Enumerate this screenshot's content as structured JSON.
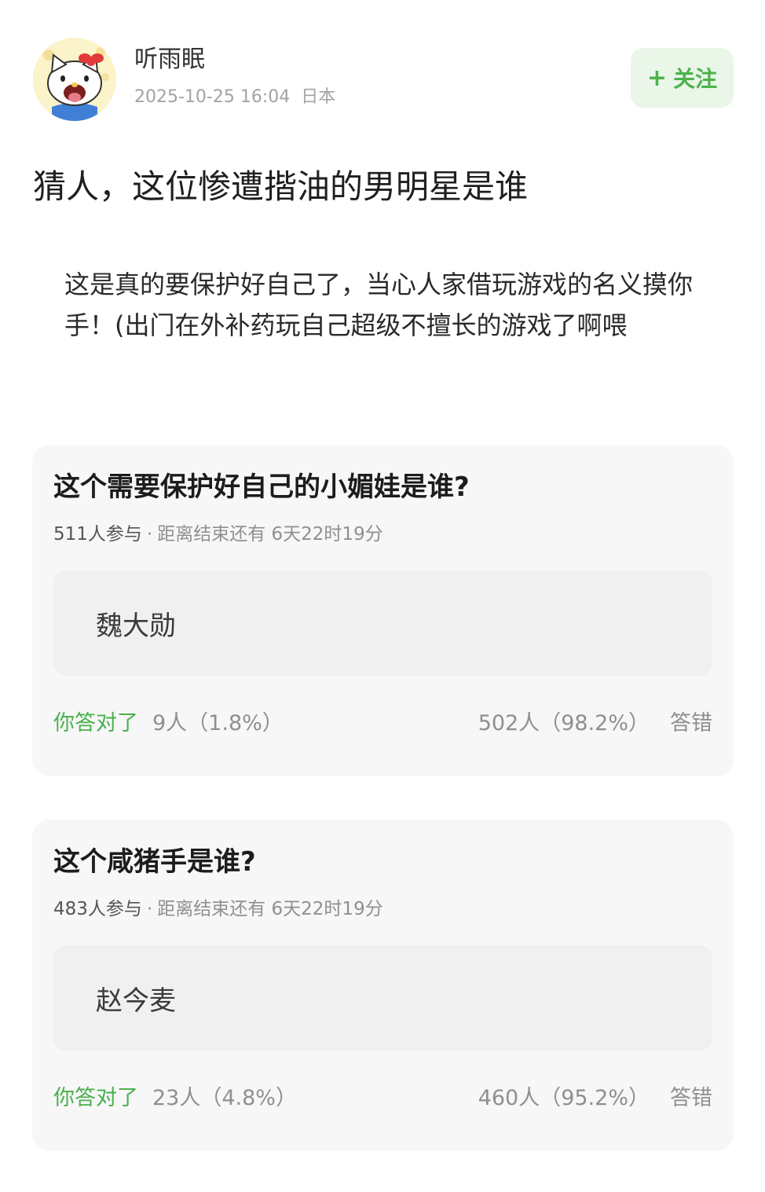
{
  "author": {
    "name": "听雨眠",
    "datetime": "2025-10-25 16:04",
    "location": "日本"
  },
  "follow": {
    "plus": "+",
    "label": "关注"
  },
  "post": {
    "title": "猜人，这位惨遭揩油的男明星是谁",
    "body": "这是真的要保护好自己了，当心人家借玩游戏的名义摸你手！(出门在外补药玩自己超级不擅长的游戏了啊喂"
  },
  "quizzes": [
    {
      "question": "这个需要保护好自己的小媚娃是谁?",
      "participants": "511人参与",
      "separator": "·",
      "deadline": "距离结束还有 6天22时19分",
      "answer": "魏大勋",
      "correct_label": "你答对了",
      "correct_count": "9人（1.8%）",
      "wrong_count": "502人（98.2%）",
      "wrong_label": "答错",
      "correct_ratio": 0.018
    },
    {
      "question": "这个咸猪手是谁?",
      "participants": "483人参与",
      "separator": "·",
      "deadline": "距离结束还有 6天22时19分",
      "answer": "赵今麦",
      "correct_label": "你答对了",
      "correct_count": "23人（4.8%）",
      "wrong_count": "460人（95.2%）",
      "wrong_label": "答错",
      "correct_ratio": 0.048
    }
  ],
  "colors": {
    "accent_green": "#49b14c",
    "follow_bg": "#e9f6e8",
    "card_bg": "#f7f7f7"
  },
  "icons": {
    "avatar": "hello-kitty-avatar-icon"
  }
}
